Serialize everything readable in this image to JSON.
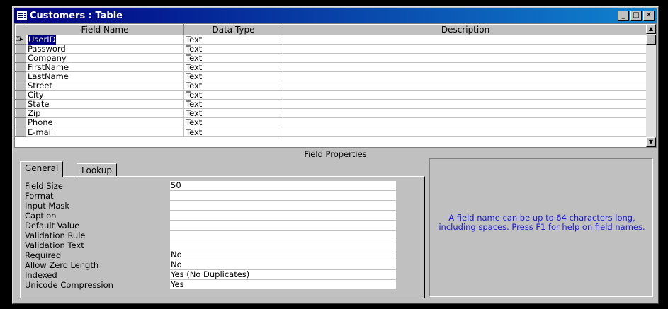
{
  "window": {
    "title": "Customers : Table",
    "minimize": "_",
    "maximize": "□",
    "close": "✕"
  },
  "grid": {
    "headers": [
      "Field Name",
      "Data Type",
      "Description"
    ],
    "rows": [
      {
        "field": "UserID",
        "type": "Text",
        "desc": ""
      },
      {
        "field": "Password",
        "type": "Text",
        "desc": ""
      },
      {
        "field": "Company",
        "type": "Text",
        "desc": ""
      },
      {
        "field": "FirstName",
        "type": "Text",
        "desc": ""
      },
      {
        "field": "LastName",
        "type": "Text",
        "desc": ""
      },
      {
        "field": "Street",
        "type": "Text",
        "desc": ""
      },
      {
        "field": "City",
        "type": "Text",
        "desc": ""
      },
      {
        "field": "State",
        "type": "Text",
        "desc": ""
      },
      {
        "field": "Zip",
        "type": "Text",
        "desc": ""
      },
      {
        "field": "Phone",
        "type": "Text",
        "desc": ""
      },
      {
        "field": "E-mail",
        "type": "Text",
        "desc": ""
      }
    ],
    "selector_icon": "key-icon"
  },
  "field_properties": {
    "heading": "Field Properties",
    "tabs": [
      "General",
      "Lookup"
    ],
    "active_tab": "General",
    "properties": [
      {
        "label": "Field Size",
        "value": "50"
      },
      {
        "label": "Format",
        "value": ""
      },
      {
        "label": "Input Mask",
        "value": ""
      },
      {
        "label": "Caption",
        "value": ""
      },
      {
        "label": "Default Value",
        "value": ""
      },
      {
        "label": "Validation Rule",
        "value": ""
      },
      {
        "label": "Validation Text",
        "value": ""
      },
      {
        "label": "Required",
        "value": "No"
      },
      {
        "label": "Allow Zero Length",
        "value": "No"
      },
      {
        "label": "Indexed",
        "value": "Yes (No Duplicates)"
      },
      {
        "label": "Unicode Compression",
        "value": "Yes"
      }
    ],
    "help_text": "A field name can be up to 64 characters long, including spaces.  Press F1 for help on field names."
  },
  "colors": {
    "title_bar": "#000080",
    "help_text": "#1a1ad0",
    "face": "#c0c0c0"
  }
}
